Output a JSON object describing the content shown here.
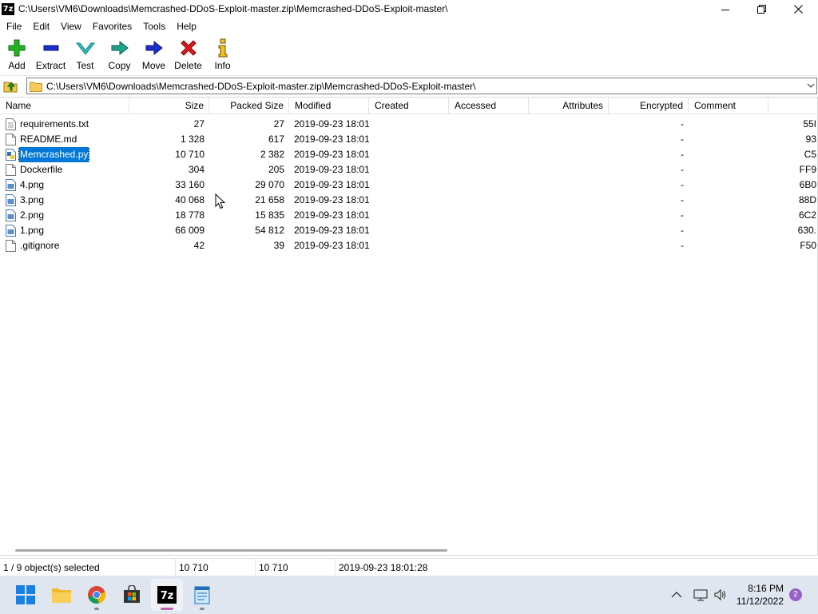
{
  "window": {
    "title": "C:\\Users\\VM6\\Downloads\\Memcrashed-DDoS-Exploit-master.zip\\Memcrashed-DDoS-Exploit-master\\",
    "app_icon_text": "7z"
  },
  "menu": [
    "File",
    "Edit",
    "View",
    "Favorites",
    "Tools",
    "Help"
  ],
  "toolbar": {
    "add": "Add",
    "extract": "Extract",
    "test": "Test",
    "copy": "Copy",
    "move": "Move",
    "delete": "Delete",
    "info": "Info"
  },
  "address": {
    "path": "C:\\Users\\VM6\\Downloads\\Memcrashed-DDoS-Exploit-master.zip\\Memcrashed-DDoS-Exploit-master\\"
  },
  "columns": {
    "name": "Name",
    "size": "Size",
    "packed": "Packed Size",
    "modified": "Modified",
    "created": "Created",
    "accessed": "Accessed",
    "attributes": "Attributes",
    "encrypted": "Encrypted",
    "comment": "Comment"
  },
  "files": [
    {
      "name": "requirements.txt",
      "size": "27",
      "packed": "27",
      "modified": "2019-09-23 18:01",
      "encrypted": "-",
      "crc": "55I",
      "icon": "text-file"
    },
    {
      "name": "README.md",
      "size": "1 328",
      "packed": "617",
      "modified": "2019-09-23 18:01",
      "encrypted": "-",
      "crc": "93",
      "icon": "blank-file"
    },
    {
      "name": "Memcrashed.py",
      "size": "10 710",
      "packed": "2 382",
      "modified": "2019-09-23 18:01",
      "encrypted": "-",
      "crc": "C5",
      "icon": "python-file",
      "selected": true
    },
    {
      "name": "Dockerfile",
      "size": "304",
      "packed": "205",
      "modified": "2019-09-23 18:01",
      "encrypted": "-",
      "crc": "FF9",
      "icon": "blank-file"
    },
    {
      "name": "4.png",
      "size": "33 160",
      "packed": "29 070",
      "modified": "2019-09-23 18:01",
      "encrypted": "-",
      "crc": "6B0",
      "icon": "image-file"
    },
    {
      "name": "3.png",
      "size": "40 068",
      "packed": "21 658",
      "modified": "2019-09-23 18:01",
      "encrypted": "-",
      "crc": "88D",
      "icon": "image-file"
    },
    {
      "name": "2.png",
      "size": "18 778",
      "packed": "15 835",
      "modified": "2019-09-23 18:01",
      "encrypted": "-",
      "crc": "6C2",
      "icon": "image-file"
    },
    {
      "name": "1.png",
      "size": "66 009",
      "packed": "54 812",
      "modified": "2019-09-23 18:01",
      "encrypted": "-",
      "crc": "630.",
      "icon": "image-file"
    },
    {
      "name": ".gitignore",
      "size": "42",
      "packed": "39",
      "modified": "2019-09-23 18:01",
      "encrypted": "-",
      "crc": "F50",
      "icon": "blank-file"
    }
  ],
  "status": {
    "selection": "1 / 9 object(s) selected",
    "size": "10 710",
    "packed": "10 710",
    "modified": "2019-09-23 18:01:28"
  },
  "taskbar": {
    "time": "8:16 PM",
    "date": "11/12/2022",
    "notifications": "2"
  },
  "colors": {
    "selection": "#0078d7",
    "taskbar": "#dfe6ef"
  }
}
